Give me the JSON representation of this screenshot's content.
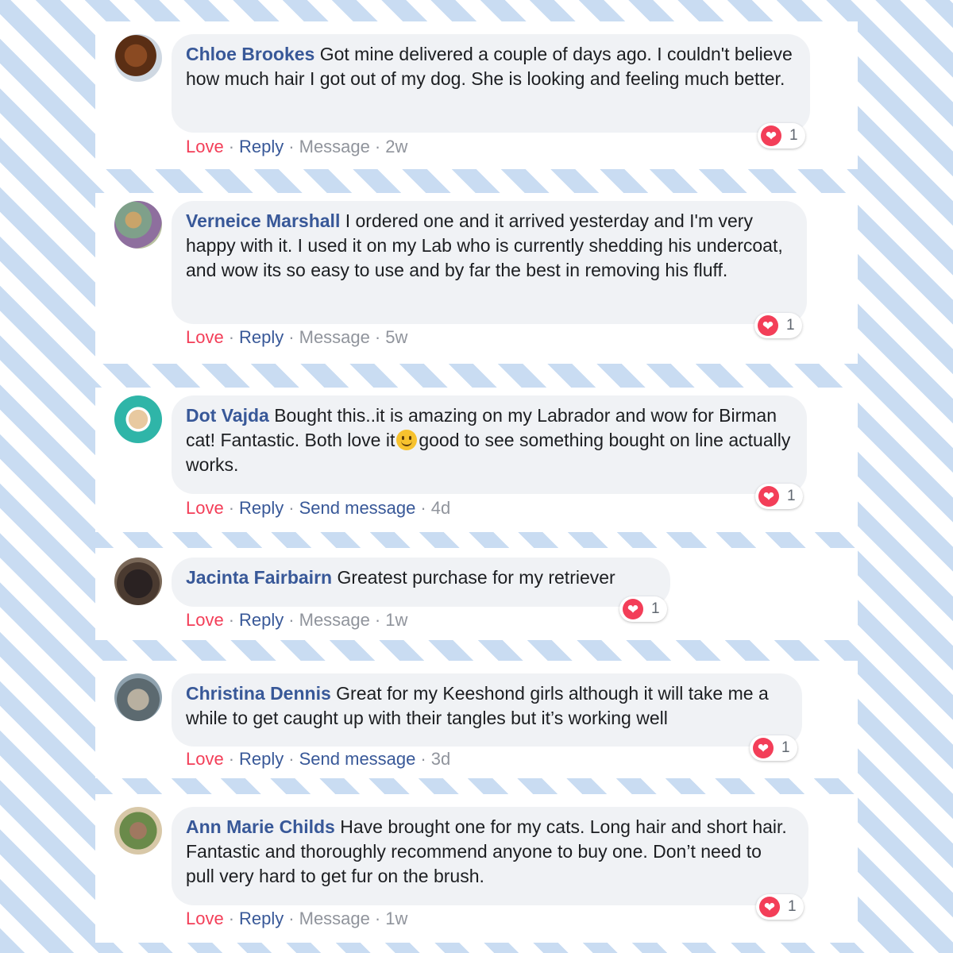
{
  "comments": [
    {
      "name": "Chloe Brookes",
      "text": "Got mine delivered a couple of days ago. I couldn't believe how much hair I got out of my dog. She is looking and feeling much better.",
      "love": "Love",
      "reply": "Reply",
      "message": "Message",
      "time": "2w",
      "reactions": "1"
    },
    {
      "name": "Verneice Marshall",
      "text": "I ordered one and it arrived yesterday and I'm very happy with it. I used it on my Lab who is currently shedding his undercoat, and wow its so easy to use and by far the best in removing his fluff.",
      "love": "Love",
      "reply": "Reply",
      "message": "Message",
      "time": "5w",
      "reactions": "1"
    },
    {
      "name": "Dot Vajda",
      "text_before_emoji": "Bought this..it is amazing on my Labrador and wow for Birman cat! Fantastic. Both love it",
      "emoji": "smiling-face-icon",
      "text_after_emoji": "good to see something bought on line actually works.",
      "love": "Love",
      "reply": "Reply",
      "message": "Send message",
      "time": "4d",
      "reactions": "1"
    },
    {
      "name": "Jacinta Fairbairn",
      "text": "Greatest purchase for my retriever",
      "love": "Love",
      "reply": "Reply",
      "message": "Message",
      "time": "1w",
      "reactions": "1"
    },
    {
      "name": "Christina Dennis",
      "text": "Great for my Keeshond girls although it will take me a while to get caught up with their tangles but it’s working well",
      "love": "Love",
      "reply": "Reply",
      "message": "Send message",
      "time": "3d",
      "reactions": "1"
    },
    {
      "name": "Ann Marie Childs",
      "text": "Have brought one for my cats. Long hair and short hair. Fantastic and thoroughly recommend anyone to buy one. Don’t need to pull very hard to get fur on the brush.",
      "love": "Love",
      "reply": "Reply",
      "message": "Message",
      "time": "1w",
      "reactions": "1"
    }
  ],
  "colors": {
    "name": "#385898",
    "love": "#f33e58",
    "meta": "#90949c",
    "bubble": "#f0f2f5",
    "stripe": "#c9dcf2"
  }
}
